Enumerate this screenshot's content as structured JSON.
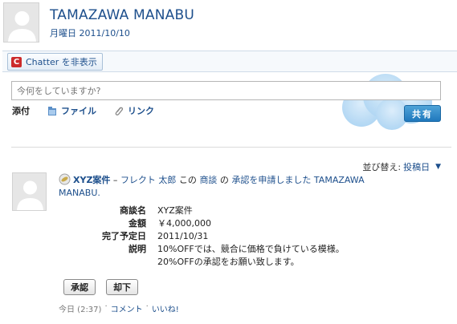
{
  "header": {
    "name": "TAMAZAWA MANABU",
    "date": "月曜日 2011/10/10"
  },
  "chatter_toggle": {
    "label": "Chatter を非表示",
    "icon": "chatter-c-icon"
  },
  "status": {
    "placeholder": "今何をしていますか?"
  },
  "attach": {
    "label": "添付",
    "file_label": "ファイル",
    "link_label": "リンク"
  },
  "share_button": "共有",
  "sort": {
    "label": "並び替え:",
    "value": "投稿日"
  },
  "feed": {
    "record_name": "XYZ案件",
    "separator": " – ",
    "actor": "フレクト 太郎",
    "text_this": " この ",
    "object_link": "商談",
    "text_no": " の ",
    "action_link": "承認を申請しました",
    "target_part1": " TAMAZAWA",
    "target_part2": "MANABU.",
    "fields": [
      {
        "label": "商談名",
        "value": "XYZ案件"
      },
      {
        "label": "金額",
        "value": "￥4,000,000"
      },
      {
        "label": "完了予定日",
        "value": "2011/10/31"
      },
      {
        "label": "説明",
        "lines": [
          "10%OFFでは、競合に価格で負けている模様。",
          "20%OFFの承認をお願い致します。"
        ]
      }
    ],
    "approve_label": "承認",
    "reject_label": "却下",
    "meta": {
      "time": "今日 (2:37)",
      "sep": "·",
      "comment": "コメント",
      "like": "いいね!"
    }
  }
}
